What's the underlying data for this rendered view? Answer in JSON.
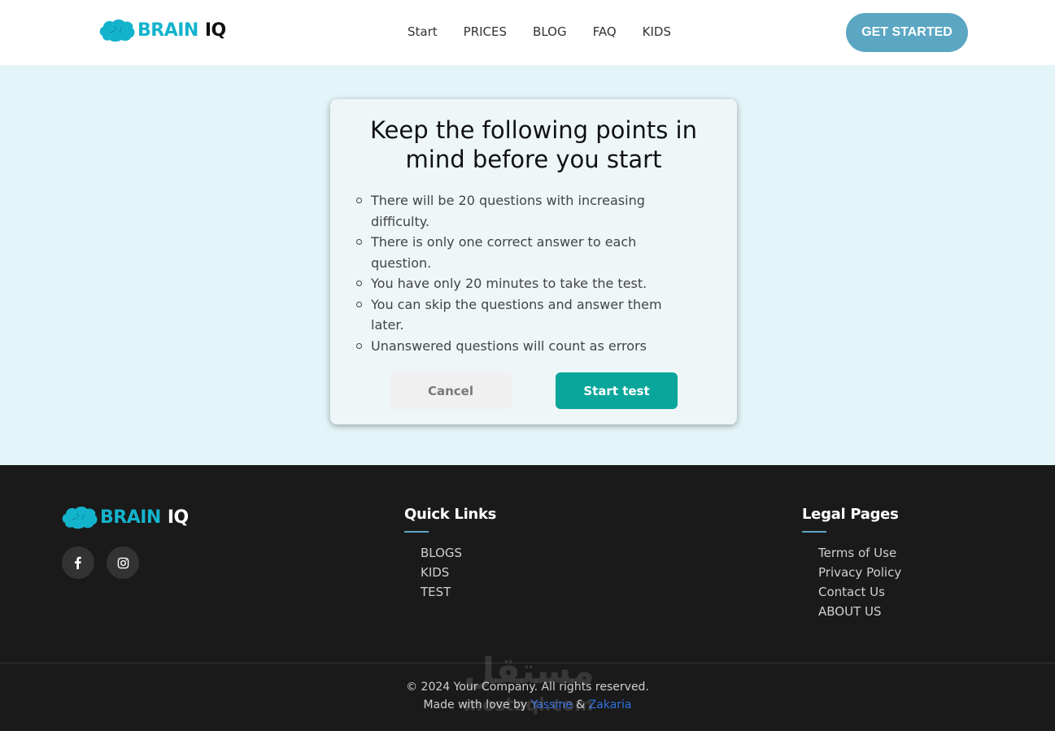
{
  "header": {
    "logo": {
      "brain": "BRAIN",
      "iq": "IQ"
    },
    "nav": [
      "Start",
      "PRICES",
      "BLOG",
      "FAQ",
      "KIDS"
    ],
    "cta_label": "GET STARTED"
  },
  "modal": {
    "title": "Keep the following points in mind before you start",
    "points": [
      "There will be 20 questions with increasing difficulty.",
      "There is only one correct answer to each question.",
      "You have only 20 minutes to take the test.",
      "You can skip the questions and answer them later.",
      "Unanswered questions will count as errors"
    ],
    "cancel_label": "Cancel",
    "start_label": "Start test"
  },
  "footer": {
    "logo": {
      "brain": "BRAIN",
      "iq": "IQ"
    },
    "social": [
      {
        "icon": "facebook-icon"
      },
      {
        "icon": "instagram-icon"
      }
    ],
    "quick_links": {
      "title": "Quick Links",
      "items": [
        "BLOGS",
        "KIDS",
        "TEST"
      ]
    },
    "legal": {
      "title": "Legal Pages",
      "items": [
        "Terms of Use",
        "Privacy Policy",
        "Contact Us",
        "ABOUT US"
      ]
    },
    "copyright": "© 2024 Your Company. All rights reserved.",
    "made_prefix": "Made with love by",
    "author1": "Yassine",
    "and": "&",
    "author2": "Zakaria",
    "watermark": "مستقل",
    "watermark_sub": "mostaql.com"
  },
  "colors": {
    "accent": "#13b3cc",
    "cta": "#5ba6c3",
    "start_button": "#0aa69b",
    "page_bg": "#e3f5f8",
    "footer_bg": "#1a1a1a"
  }
}
